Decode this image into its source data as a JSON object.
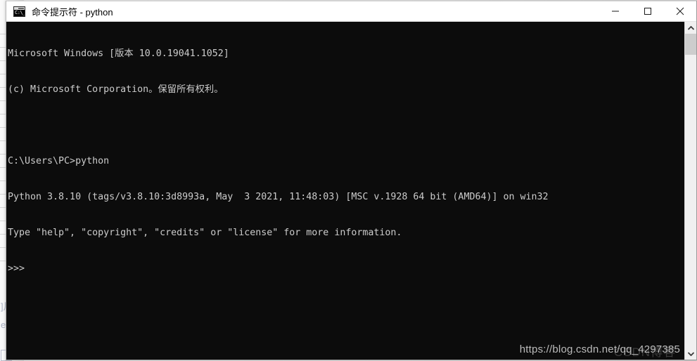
{
  "window": {
    "title": "命令提示符 - python",
    "icon": "cmd-console-icon",
    "icon_prompt": "C:\\_",
    "controls": {
      "minimize": "minimize-icon",
      "maximize": "maximize-icon",
      "close": "close-icon"
    }
  },
  "console": {
    "background": "#0c0c0c",
    "foreground": "#cccccc",
    "lines": [
      "Microsoft Windows [版本 10.0.19041.1052]",
      "(c) Microsoft Corporation。保留所有权利。",
      "",
      "C:\\Users\\PC>python",
      "Python 3.8.10 (tags/v3.8.10:3d8993a, May  3 2021, 11:48:03) [MSC v.1928 64 bit (AMD64)] on win32",
      "Type \"help\", \"copyright\", \"credits\" or \"license\" for more information.",
      ">>>"
    ]
  },
  "watermark": {
    "url": "https://blog.csdn.net/qq_4297385",
    "logo": "CSDN博客"
  },
  "scrollbar": {
    "up_arrow": "chevron-up-icon",
    "down_arrow": "chevron-down-icon",
    "thumb_position_percent": 0,
    "track_color": "#f0f0f0",
    "thumb_color": "#cdcdcd"
  },
  "background_page": {
    "lines": [
      "]片",
      "e/",
      ""
    ]
  }
}
